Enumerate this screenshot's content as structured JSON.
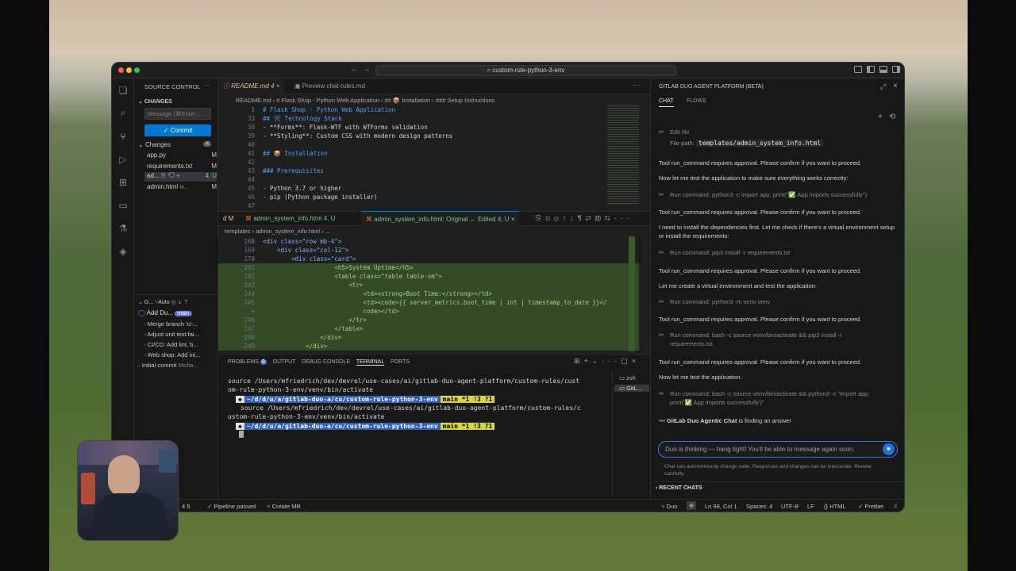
{
  "window": {
    "title": "custom-rule-python-3-env"
  },
  "scm": {
    "header": "SOURCE CONTROL",
    "changes_header": "CHANGES",
    "message_placeholder": "Message (⌘Enter...",
    "commit_label": "Commit",
    "changes_label": "Changes",
    "changes_count": "4",
    "files": [
      {
        "name": "app.py",
        "status": "M"
      },
      {
        "name": "requirements.txt",
        "status": "M"
      },
      {
        "name": "ad...",
        "status": "4, U"
      },
      {
        "name": "admin.html",
        "path": "te...",
        "status": "M"
      }
    ],
    "graph_header": "G...",
    "graph_auto": "Auto",
    "commits": [
      {
        "text": "Add Du...",
        "branch": "main"
      },
      {
        "text": "Merge branch 'ci-..."
      },
      {
        "text": "Adjust unit test fai..."
      },
      {
        "text": "CI/CD: Add lint, b..."
      },
      {
        "text": "Web shop: Add ini..."
      },
      {
        "text": "Initial commit",
        "author": "Micha..."
      }
    ]
  },
  "editor": {
    "tabs": [
      {
        "label": "README.md",
        "badge": "4"
      },
      {
        "label": "Preview chat-rules.md"
      }
    ],
    "breadcrumb": [
      "README.md",
      "# Flask Shop - Python Web Application",
      "## 📦 Installation",
      "### Setup Instructions"
    ],
    "top_lines": [
      {
        "n": "1",
        "t": "# Flask Shop - Python Web Application"
      },
      {
        "n": "33",
        "t": "## 🛠 Technology Stack"
      },
      {
        "n": "38",
        "t": "- **Forms**: Flask-WTF with WTForms validation"
      },
      {
        "n": "39",
        "t": "- **Styling**: Custom CSS with modern design patterns"
      },
      {
        "n": "40",
        "t": ""
      },
      {
        "n": "41",
        "t": "## 📦 Installation"
      },
      {
        "n": "42",
        "t": ""
      },
      {
        "n": "43",
        "t": "### Prerequisites"
      },
      {
        "n": "44",
        "t": ""
      },
      {
        "n": "45",
        "t": "- Python 3.7 or higher"
      },
      {
        "n": "46",
        "t": "- pip (Python package installer)"
      },
      {
        "n": "47",
        "t": ""
      }
    ],
    "diff_tabs": [
      {
        "label": "d",
        "badge": "M"
      },
      {
        "label": "admin_system_info.html",
        "badge": "4, U"
      },
      {
        "label": "admin_system_info.html: Original ↔ Edited",
        "badge": "4, U"
      }
    ],
    "diff_breadcrumb": [
      "templates",
      "admin_system_info.html",
      "..."
    ],
    "sticky_lines": [
      {
        "n": "168",
        "t": "<div class=\"row mb-4\">"
      },
      {
        "n": "169",
        "t": "    <div class=\"col-12\">"
      },
      {
        "n": "170",
        "t": "        <div class=\"card\">"
      }
    ],
    "diff_lines": [
      {
        "n": "241",
        "t": "                    <h5>System Uptime</h5>"
      },
      {
        "n": "242",
        "t": "                    <table class=\"table table-sm\">"
      },
      {
        "n": "243",
        "t": "                        <tr>"
      },
      {
        "n": "244",
        "t": "                            <td><strong>Boot Time:</strong></td>"
      },
      {
        "n": "245",
        "t": "                            <td><code>{{ server_metrics.boot_time | int | timestamp_to_date }}</"
      },
      {
        "n": "+",
        "t": "                            code></td>"
      },
      {
        "n": "246",
        "t": "                        </tr>"
      },
      {
        "n": "247",
        "t": "                    </table>"
      },
      {
        "n": "248",
        "t": "                </div>"
      },
      {
        "n": "249",
        "t": "            </div>"
      }
    ]
  },
  "panel": {
    "tabs": [
      {
        "label": "PROBLEMS",
        "badge": "9"
      },
      {
        "label": "OUTPUT"
      },
      {
        "label": "DEBUG CONSOLE"
      },
      {
        "label": "TERMINAL"
      },
      {
        "label": "PORTS"
      }
    ],
    "terminal_lines": [
      "source /Users/mfriedrich/dev/devrel/use-cases/ai/gitlab-duo-agent-platform/custom-rules/cust",
      "om-rule-python-3-env/venv/bin/activate"
    ],
    "prompt_path": "~/d/d/u/a/gitlab-duo-a/cu/custom-rule-python-3-env",
    "prompt_branch": "main *1 !3 ?1",
    "cmd2": "source /Users/mfriedrich/dev/devrel/use-cases/ai/gitlab-duo-agent-platform/custom-rules/c",
    "cmd2b": "ustom-rule-python-3-env/venv/bin/activate",
    "shells": [
      "zsh",
      "GitL..."
    ]
  },
  "status": {
    "left_count": "4  5",
    "pipeline": "Pipeline passed",
    "create_mr": "Create MR",
    "duo": "Duo",
    "position": "Ln 98, Col 1",
    "spaces": "Spaces: 4",
    "encoding": "UTF-8",
    "eol": "LF",
    "language": "HTML",
    "formatter": "Prettier"
  },
  "chat": {
    "title": "GITLAB DUO AGENT PLATFORM (BETA)",
    "tabs": [
      "CHAT",
      "FLOWS"
    ],
    "edit_file": "Edit file",
    "file_path_label": "File path:",
    "file_path": "templates/admin_system_info.html",
    "m1": "Tool run_command requires approval. Please confirm if you want to proceed.",
    "m2": "Now let me test the application to make sure everything works correctly:",
    "t1": "Run command: python3 -c import app; print(\"✅ App imports successfully\")",
    "m3": "Tool run_command requires approval. Please confirm if you want to proceed.",
    "m4": "I need to install the dependencies first. Let me check if there's a virtual environment setup or install the requirements:",
    "t2": "Run command: pip3 install -r requirements.txt",
    "m5": "Tool run_command requires approval. Please confirm if you want to proceed.",
    "m6": "Let me create a virtual environment and test the application:",
    "t3": "Run command: python3 -m venv venv",
    "m7": "Tool run_command requires approval. Please confirm if you want to proceed.",
    "t4": "Run command: bash -c source venv/bin/activate && pip3 install -r requirements.txt",
    "m8": "Tool run_command requires approval. Please confirm if you want to proceed.",
    "m9": "Now let me test the application:",
    "t5": "Run command: bash -c source venv/bin/activate && python3 -c \"import app; print('✅ App imports successfully')\"",
    "thinking_name": "GitLab Duo Agentic Chat",
    "thinking_text": "is finding an answer",
    "input_placeholder": "Duo is thinking — hang tight! You'll be able to message again soon.",
    "disclaimer": "Chat can autonomously change code. Responses and changes can be inaccurate. Review carefully.",
    "recent": "RECENT CHATS"
  },
  "colors": {
    "accent": "#0078d4",
    "diff_green": "#3b5a2a",
    "chat_input_border": "#3a7bd5",
    "prompt_yellow": "#d7d73a",
    "prompt_blue": "#2f5fb8"
  }
}
